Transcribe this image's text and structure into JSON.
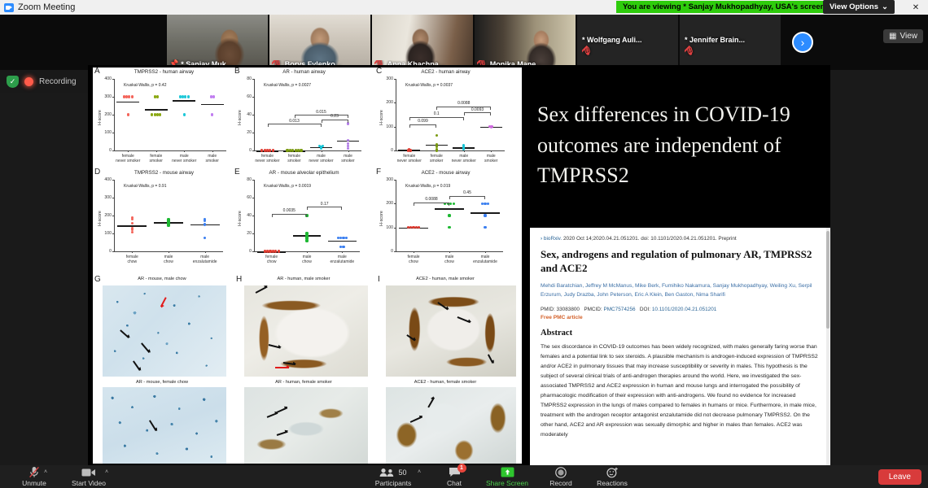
{
  "window": {
    "title": "Zoom Meeting",
    "minimize": "–",
    "maximize": "❐",
    "close": "✕"
  },
  "viewing_banner": {
    "text": "You are viewing * Sanjay Mukhopadhyay, USA's screen",
    "view_options": "View Options",
    "chevron": "⌄",
    "bg": "#2ecc0c"
  },
  "filmstrip": {
    "tiles": [
      {
        "name": "* Sanjay Muk...",
        "muted": true,
        "pinned": true,
        "video": true,
        "active": true
      },
      {
        "name": "Borys Fylenko...",
        "muted": true,
        "pinned": false,
        "video": true,
        "active": false
      },
      {
        "name": "Anna Khachpa...",
        "muted": true,
        "pinned": false,
        "video": true,
        "active": false
      },
      {
        "name": "Monika Mane...",
        "muted": true,
        "pinned": false,
        "video": true,
        "active": false
      },
      {
        "name": "* Wolfgang Auli...",
        "muted": true,
        "pinned": false,
        "video": false,
        "active": false
      },
      {
        "name": "* Jennifer Brain...",
        "muted": true,
        "pinned": false,
        "video": false,
        "active": false
      }
    ],
    "next_arrow": "›",
    "view_chip": "View"
  },
  "recording": {
    "label": "Recording",
    "shield": "✓"
  },
  "slide": {
    "title": "Sex differences in COVID-19 outcomes are independent of TMPRSS2"
  },
  "paper": {
    "source": "bioRxiv. 2020 Oct 14;2020.04.21.051201. doi: 10.1101/2020.04.21.051201. Preprint",
    "source_journal": "bioRxiv.",
    "chevron": "›",
    "title": "Sex, androgens and regulation of pulmonary AR, TMPRSS2 and ACE2",
    "authors": "Mehdi Baratchian, Jeffrey M McManus, Mike Berk, Fumihiko Nakamura, Sanjay Mukhopadhyay, Weiling Xu, Serpil Erzurum, Judy Drazba, John Peterson, Eric A Klein, Ben Gaston, Nima Sharifi",
    "pmid_label": "PMID:",
    "pmid": "33083800",
    "pmcid_label": "PMCID:",
    "pmcid": "PMC7574256",
    "doi_label": "DOI:",
    "doi": "10.1101/2020.04.21.051201",
    "free_article": "Free PMC article",
    "abstract_heading": "Abstract",
    "abstract": "The sex discordance in COVID-19 outcomes has been widely recognized, with males generally faring worse than females and a potential link to sex steroids. A plausible mechanism is androgen-induced expression of TMPRSS2 and/or ACE2 in pulmonary tissues that may increase susceptibility or severity in males. This hypothesis is the subject of several clinical trials of anti-androgen therapies around the world. Here, we investigated the sex-associated TMPRSS2 and ACE2 expression in human and mouse lungs and interrogated the possibility of pharmacologic modification of their expression with anti-androgens. We found no evidence for increased TMPRSS2 expression in the lungs of males compared to females in humans or mice. Furthermore, in male mice, treatment with the androgen receptor antagonist enzalutamide did not decrease pulmonary TMPRSS2. On the other hand, ACE2 and AR expression was sexually dimorphic and higher in males than females. ACE2 was moderately"
  },
  "chart_data": [
    {
      "panel": "A",
      "type": "scatter",
      "title": "TMPRSS2 - human airway",
      "annotation": "Kruskal-Wallis, p = 0.42",
      "ylabel": "H-score",
      "ylim": [
        0,
        400
      ],
      "yticks": [
        0,
        100,
        200,
        300,
        400
      ],
      "categories": [
        "female\nnever smoker",
        "female\nsmoker",
        "male\nnever smoker",
        "male\nsmoker"
      ],
      "colors": [
        "#f4645a",
        "#8aa812",
        "#1ec8d8",
        "#c07cf0"
      ],
      "medians": [
        275,
        232,
        282,
        260
      ],
      "series": [
        {
          "name": "female never smoker",
          "values": [
            300,
            300,
            300,
            300,
            200
          ]
        },
        {
          "name": "female smoker",
          "values": [
            300,
            300,
            200,
            200,
            200,
            200
          ]
        },
        {
          "name": "male never smoker",
          "values": [
            300,
            300,
            300,
            300,
            200
          ]
        },
        {
          "name": "male smoker",
          "values": [
            300,
            300,
            200
          ]
        }
      ],
      "brackets": []
    },
    {
      "panel": "B",
      "type": "scatter",
      "title": "AR - human airway",
      "annotation": "Kruskal-Wallis, p = 0.0027",
      "ylabel": "H-score",
      "ylim": [
        0,
        80
      ],
      "yticks": [
        0,
        20,
        40,
        60,
        80
      ],
      "categories": [
        "female\nnever smoker",
        "female\nsmoker",
        "male\nnever smoker",
        "male\nsmoker"
      ],
      "colors": [
        "#e03c31",
        "#7a9a10",
        "#16c4d6",
        "#b07ae8"
      ],
      "medians": [
        0,
        0,
        4,
        11
      ],
      "series": [
        {
          "name": "female never smoker",
          "values": [
            0,
            0,
            0,
            0,
            0
          ]
        },
        {
          "name": "female smoker",
          "values": [
            0,
            0,
            0,
            0,
            0,
            0
          ]
        },
        {
          "name": "male never smoker",
          "values": [
            5,
            5,
            4,
            3,
            2
          ]
        },
        {
          "name": "male smoker",
          "values": [
            30,
            11,
            8,
            5,
            2
          ]
        }
      ],
      "brackets": [
        {
          "from": 1,
          "to": 3,
          "label": "0.013",
          "y": 30
        },
        {
          "from": 2,
          "to": 4,
          "label": "0.015",
          "y": 40
        },
        {
          "from": 3,
          "to": 4,
          "label": "0.23",
          "y": 35
        }
      ]
    },
    {
      "panel": "C",
      "type": "scatter",
      "title": "ACE2 - human airway",
      "annotation": "Kruskal-Wallis, p = 0.0037",
      "ylabel": "H-score",
      "ylim": [
        0,
        300
      ],
      "yticks": [
        0,
        100,
        200,
        300
      ],
      "categories": [
        "female\nnever smoker",
        "female\nsmoker",
        "male\nnever smoker",
        "male\nsmoker"
      ],
      "colors": [
        "#e03c31",
        "#7a9a10",
        "#16c4d6",
        "#d06ae0"
      ],
      "medians": [
        3,
        25,
        12,
        100
      ],
      "series": [
        {
          "name": "female never smoker",
          "values": [
            5,
            3,
            2,
            0,
            0
          ]
        },
        {
          "name": "female smoker",
          "values": [
            62,
            25,
            20,
            15,
            5,
            0
          ]
        },
        {
          "name": "male never smoker",
          "values": [
            22,
            18,
            12,
            8,
            5
          ]
        },
        {
          "name": "male smoker",
          "values": [
            102,
            100,
            100,
            98
          ]
        }
      ],
      "brackets": [
        {
          "from": 1,
          "to": 2,
          "label": "0.099",
          "y": 110
        },
        {
          "from": 1,
          "to": 3,
          "label": "0.1",
          "y": 140
        },
        {
          "from": 2,
          "to": 4,
          "label": "0.0088",
          "y": 185
        },
        {
          "from": 3,
          "to": 4,
          "label": "0.0093",
          "y": 160
        }
      ]
    },
    {
      "panel": "D",
      "type": "scatter",
      "title": "TMPRSS2 - mouse airway",
      "annotation": "Kruskal-Wallis, p = 0.91",
      "ylabel": "H-score",
      "ylim": [
        0,
        400
      ],
      "yticks": [
        0,
        100,
        200,
        300,
        400
      ],
      "categories": [
        "female\nchow",
        "male\nchow",
        "male\nenzalutamide"
      ],
      "colors": [
        "#f4645a",
        "#1db832",
        "#3a7ef0"
      ],
      "medians": [
        145,
        162,
        152
      ],
      "series": [
        {
          "name": "female chow",
          "values": [
            188,
            178,
            155,
            130,
            120,
            105
          ]
        },
        {
          "name": "male chow",
          "values": [
            180,
            175,
            170,
            165,
            160,
            155,
            150,
            145
          ]
        },
        {
          "name": "male enzalutamide",
          "values": [
            180,
            172,
            150,
            75
          ]
        }
      ],
      "brackets": []
    },
    {
      "panel": "E",
      "type": "scatter",
      "title": "AR - mouse alveolar epithelium",
      "annotation": "Kruskal-Wallis, p = 0.0019",
      "ylabel": "H-score",
      "ylim": [
        0,
        80
      ],
      "yticks": [
        0,
        20,
        40,
        60,
        80
      ],
      "categories": [
        "female\nchow",
        "male\nchow",
        "male\nenzalutamide"
      ],
      "colors": [
        "#e03c31",
        "#1db832",
        "#3a7ef0"
      ],
      "medians": [
        0,
        18,
        12
      ],
      "series": [
        {
          "name": "female chow",
          "values": [
            0,
            0,
            0,
            0,
            0,
            0
          ]
        },
        {
          "name": "male chow",
          "values": [
            40,
            20,
            18,
            16,
            15,
            14,
            12,
            11
          ]
        },
        {
          "name": "male enzalutamide",
          "values": [
            15,
            15,
            15,
            15,
            5,
            5
          ]
        }
      ],
      "brackets": [
        {
          "from": 1,
          "to": 2,
          "label": "0.0035",
          "y": 42
        },
        {
          "from": 2,
          "to": 3,
          "label": "0.17",
          "y": 50
        }
      ]
    },
    {
      "panel": "F",
      "type": "scatter",
      "title": "ACE2 - mouse airway",
      "annotation": "Kruskal-Wallis, p = 0.019",
      "ylabel": "H-score",
      "ylim": [
        0,
        300
      ],
      "yticks": [
        0,
        100,
        200,
        300
      ],
      "categories": [
        "female\nchow",
        "male\nchow",
        "male\nenzalutamide"
      ],
      "colors": [
        "#e03c31",
        "#1db832",
        "#3a7ef0"
      ],
      "medians": [
        100,
        180,
        162
      ],
      "series": [
        {
          "name": "female chow",
          "values": [
            100,
            100,
            100,
            100,
            100
          ]
        },
        {
          "name": "male chow",
          "values": [
            200,
            200,
            200,
            200,
            150,
            100
          ]
        },
        {
          "name": "male enzalutamide",
          "values": [
            200,
            200,
            200,
            150,
            100
          ]
        }
      ],
      "brackets": [
        {
          "from": 1,
          "to": 2,
          "label": "0.0088",
          "y": 205
        },
        {
          "from": 2,
          "to": 3,
          "label": "0.45",
          "y": 232
        }
      ]
    }
  ],
  "histology": [
    {
      "panel": "G",
      "top_caption": "AR - mouse, male chow",
      "bottom_caption": "AR - mouse, female chow"
    },
    {
      "panel": "H",
      "top_caption": "AR - human, male smoker",
      "bottom_caption": "AR - human, female smoker"
    },
    {
      "panel": "I",
      "top_caption": "ACE2 - human, male smoker",
      "bottom_caption": "ACE2 - human, female smoker"
    }
  ],
  "toolbar": {
    "unmute": "Unmute",
    "start_video": "Start Video",
    "participants": "Participants",
    "participants_count": "50",
    "chat": "Chat",
    "chat_badge": "1",
    "share_screen": "Share Screen",
    "record": "Record",
    "reactions": "Reactions",
    "leave": "Leave",
    "caret": "˄"
  }
}
